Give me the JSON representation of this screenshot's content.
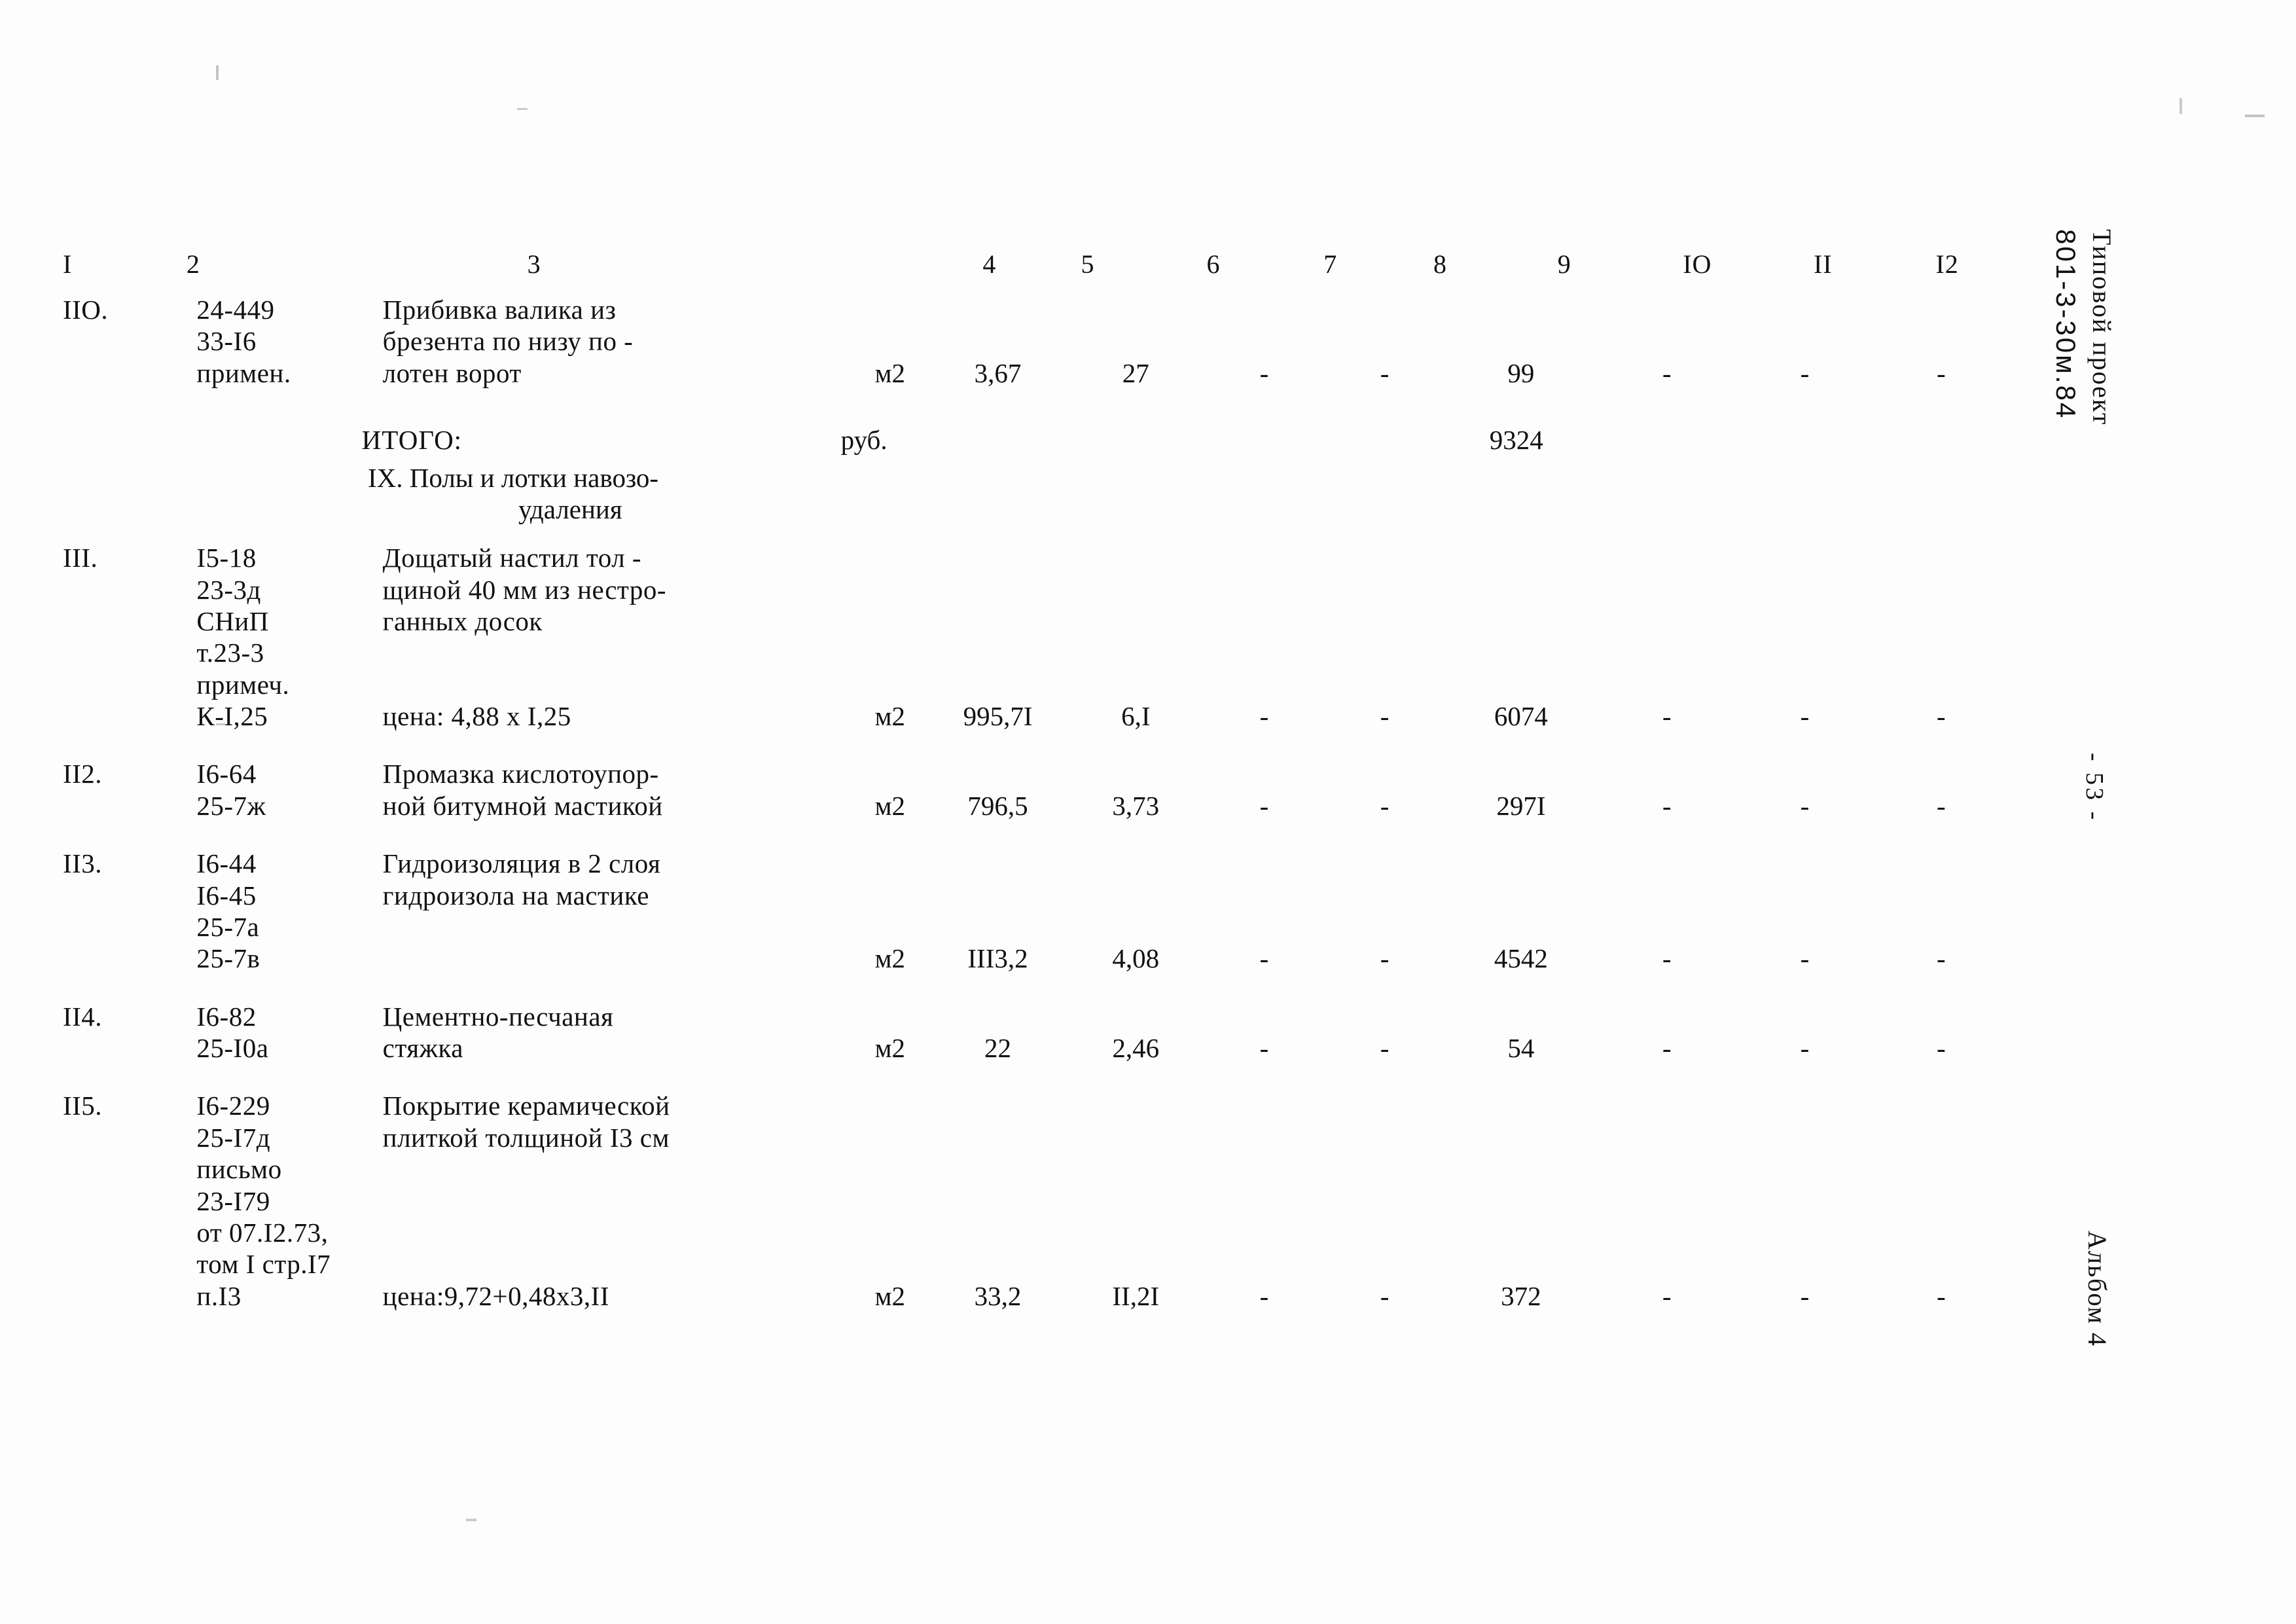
{
  "document": {
    "margin": {
      "project_label": "Типовой проект",
      "project_code": "801-3-30м.84",
      "page_number": "- 53 -",
      "album": "Альбом 4"
    }
  },
  "table": {
    "column_headers": [
      "I",
      "2",
      "3",
      "4",
      "5",
      "6",
      "7",
      "8",
      "9",
      "IO",
      "II",
      "I2"
    ],
    "rows": [
      {
        "kind": "entry",
        "num": "IIO.",
        "codes": [
          "24-449",
          "33-I6",
          "примен."
        ],
        "desc": [
          "Прибивка валика из",
          "брезента по низу по -",
          "лотен ворот"
        ],
        "unit": "м2",
        "c5": "3,67",
        "c6": "27",
        "c7": "-",
        "c8": "-",
        "c9": "99",
        "c10": "-",
        "c11": "-",
        "c12": "-"
      },
      {
        "kind": "total",
        "label": "ИТОГО:",
        "unit": "руб.",
        "c9": "9324"
      },
      {
        "kind": "section",
        "line1": "IX. Полы и лотки навозо-",
        "line2": "удаления"
      },
      {
        "kind": "entry",
        "num": "III.",
        "codes": [
          "I5-18",
          "23-3д",
          "СНиП",
          "т.23-3",
          "примеч.",
          "К-I,25"
        ],
        "desc": [
          "Дощатый настил тол -",
          "щиной 40 мм из нестро-",
          "ганных досок",
          "",
          "",
          "цена: 4,88 х I,25"
        ],
        "unit": "м2",
        "c5": "995,7I",
        "c6": "6,I",
        "c7": "-",
        "c8": "-",
        "c9": "6074",
        "c10": "-",
        "c11": "-",
        "c12": "-"
      },
      {
        "kind": "entry",
        "num": "II2.",
        "codes": [
          "I6-64",
          "25-7ж"
        ],
        "desc": [
          "Промазка кислотоупор-",
          "ной битумной мастикой"
        ],
        "unit": "м2",
        "c5": "796,5",
        "c6": "3,73",
        "c7": "-",
        "c8": "-",
        "c9": "297I",
        "c10": "-",
        "c11": "-",
        "c12": "-"
      },
      {
        "kind": "entry",
        "num": "II3.",
        "codes": [
          "I6-44",
          "I6-45",
          "25-7а",
          "25-7в"
        ],
        "desc": [
          "Гидроизоляция в 2 слоя",
          "гидроизола на мастике",
          "",
          ""
        ],
        "unit": "м2",
        "c5": "III3,2",
        "c6": "4,08",
        "c7": "-",
        "c8": "-",
        "c9": "4542",
        "c10": "-",
        "c11": "-",
        "c12": "-"
      },
      {
        "kind": "entry",
        "num": "II4.",
        "codes": [
          "I6-82",
          "25-I0а"
        ],
        "desc": [
          "Цементно-песчаная",
          "стяжка"
        ],
        "unit": "м2",
        "c5": "22",
        "c6": "2,46",
        "c7": "-",
        "c8": "-",
        "c9": "54",
        "c10": "-",
        "c11": "-",
        "c12": "-"
      },
      {
        "kind": "entry",
        "num": "II5.",
        "codes": [
          "I6-229",
          "25-I7д",
          "письмо",
          "23-I79",
          "от 07.I2.73,",
          "том I стр.I7",
          "п.I3"
        ],
        "desc": [
          "Покрытие керамической",
          "плиткой толщиной I3 см",
          "",
          "",
          "",
          "",
          "цена:9,72+0,48х3,II"
        ],
        "unit": "м2",
        "c5": "33,2",
        "c6": "II,2I",
        "c7": "-",
        "c8": "-",
        "c9": "372",
        "c10": "-",
        "c11": "-",
        "c12": "-"
      }
    ]
  }
}
